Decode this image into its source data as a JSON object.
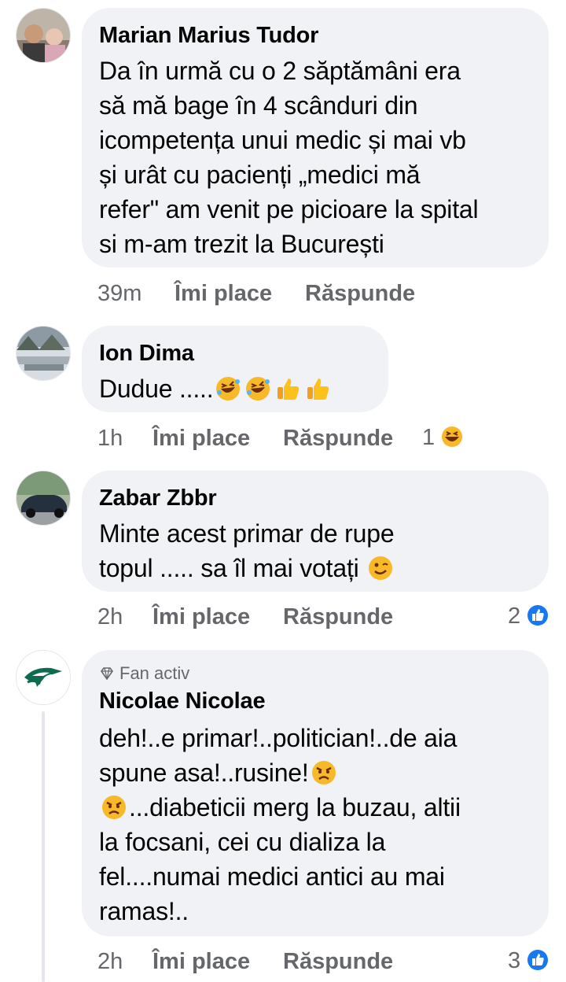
{
  "comments": [
    {
      "author": "Marian Marius Tudor",
      "text": "Da în urmă cu o 2 săptămâni era să mă bage în 4 scânduri din icompetența unui medic și mai vb și urât cu pacienți „medici mă refer\" am venit pe picioare la spital si m-am trezit la București",
      "lines": [
        "Da în urmă cu o 2 săptămâni era",
        "să mă bage în 4 scânduri din",
        "icompetența unui medic și mai vb",
        "și urât cu pacienți „medici mă",
        "refer\" am venit pe picioare la spital",
        "si m-am trezit la București"
      ],
      "time": "39m",
      "like": "Îmi place",
      "reply": "Răspunde"
    },
    {
      "author": "Ion Dima",
      "text": "Dudue .....",
      "time": "1h",
      "like": "Îmi place",
      "reply": "Răspunde",
      "reaction_count": "1",
      "reaction": "haha-icon"
    },
    {
      "author": "Zabar Zbbr",
      "lines": [
        "Minte acest primar de rupe",
        "topul ..... sa îl mai votați"
      ],
      "time": "2h",
      "like": "Îmi place",
      "reply": "Răspunde",
      "reaction_count": "2",
      "reaction": "like-icon"
    },
    {
      "badge": "Fan activ",
      "author": "Nicolae Nicolae",
      "lines": [
        "deh!..e primar!..politician!..de aia",
        "spune asa!..rusine!",
        "...diabeticii merg la buzau, altii",
        "la focsani, cei cu dializa la",
        "fel....numai medici antici au mai",
        "ramas!.."
      ],
      "time": "2h",
      "like": "Îmi place",
      "reply": "Răspunde",
      "reaction_count": "3",
      "reaction": "like-icon"
    }
  ],
  "colors": {
    "bubble": "#f0f2f5",
    "meta": "#65676b",
    "like_blue": "#1877f2"
  }
}
